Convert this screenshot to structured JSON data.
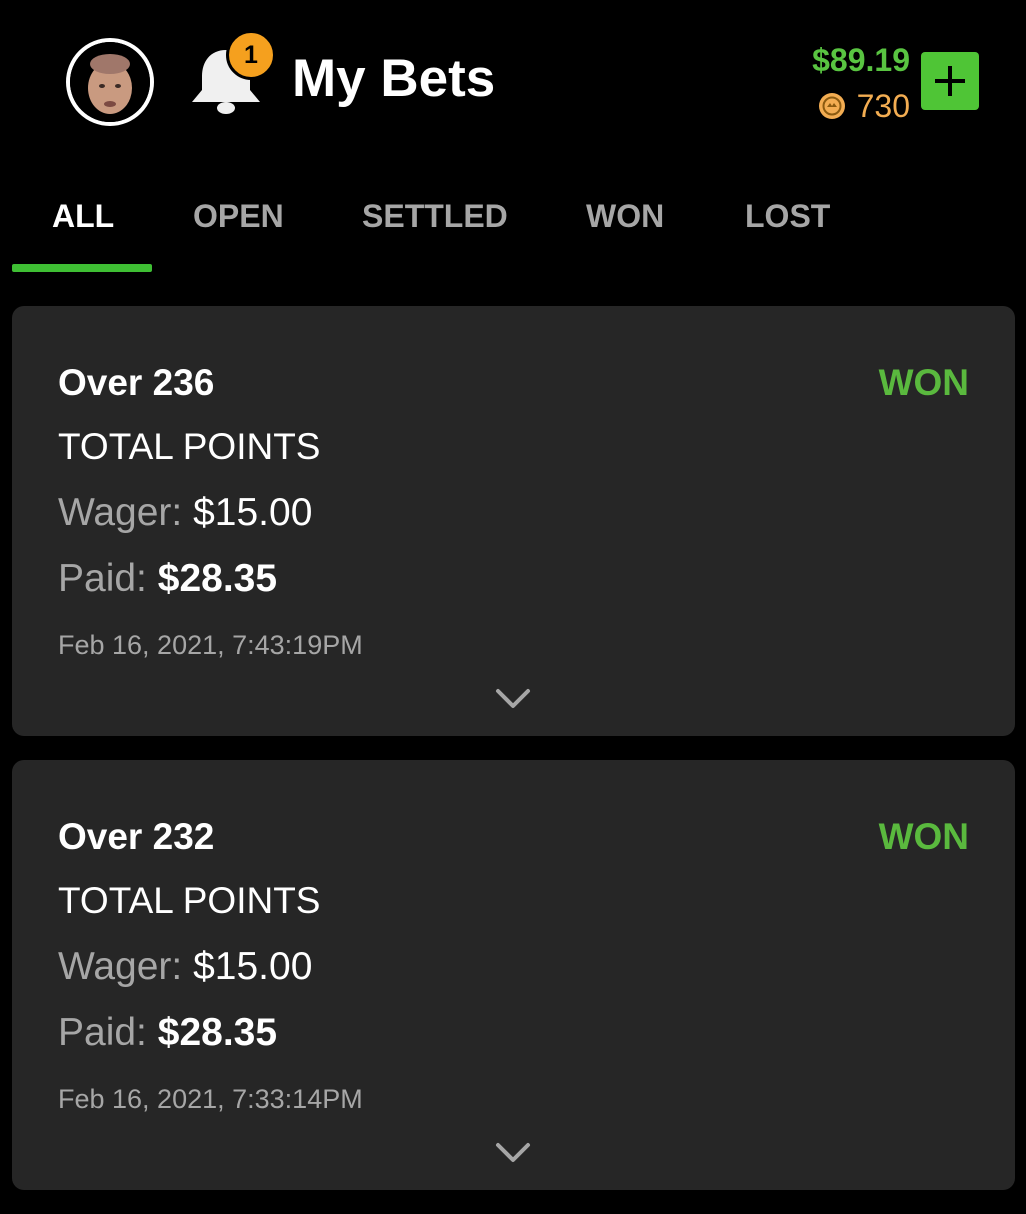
{
  "header": {
    "title": "My Bets",
    "notification_count": "1",
    "balance": "$89.19",
    "coins": "730",
    "avatar_icon": "user-avatar",
    "bell_icon": "bell-icon",
    "add_icon": "plus-icon"
  },
  "tabs": [
    {
      "label": "ALL",
      "active": true
    },
    {
      "label": "OPEN",
      "active": false
    },
    {
      "label": "SETTLED",
      "active": false
    },
    {
      "label": "WON",
      "active": false
    },
    {
      "label": "LOST",
      "active": false
    }
  ],
  "bets": [
    {
      "selection": "Over 236",
      "status": "WON",
      "market": "TOTAL POINTS",
      "wager_label": "Wager:",
      "wager": "$15.00",
      "paid_label": "Paid:",
      "paid": "$28.35",
      "date": "Feb 16, 2021, 7:43:19PM"
    },
    {
      "selection": "Over 232",
      "status": "WON",
      "market": "TOTAL POINTS",
      "wager_label": "Wager:",
      "wager": "$15.00",
      "paid_label": "Paid:",
      "paid": "$28.35",
      "date": "Feb 16, 2021, 7:33:14PM"
    }
  ],
  "colors": {
    "background": "#000000",
    "card": "#262626",
    "accent_green": "#4fc536",
    "won_green": "#5ab93e",
    "balance_green": "#59c441",
    "coin_orange": "#f3ad52",
    "badge_orange": "#f5a01e",
    "muted_text": "#a6a6a6"
  }
}
